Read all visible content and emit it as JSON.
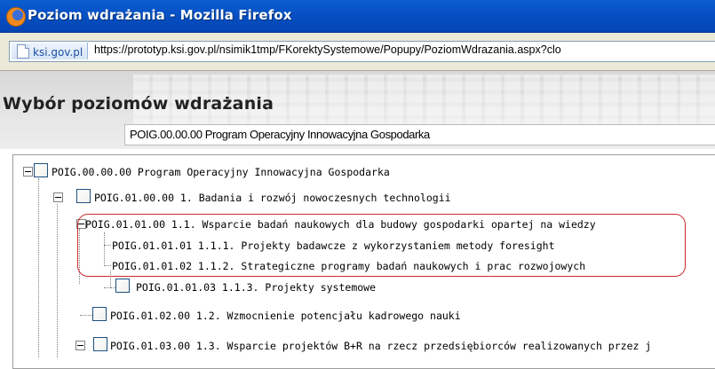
{
  "window": {
    "title": "Poziom wdrażania - Mozilla Firefox",
    "icon": "firefox-icon"
  },
  "urlbar": {
    "site_identity": "ksi.gov.pl",
    "url": "https://prototyp.ksi.gov.pl/nsimik1tmp/FKorektySystemowe/Popupy/PoziomWdrazania.aspx?clo"
  },
  "page": {
    "title": "Wybór poziomów wdrażania",
    "selected_value": "POIG.00.00.00 Program Operacyjny Innowacyjna Gospodarka"
  },
  "tree": {
    "nodes": [
      {
        "label": "POIG.00.00.00 Program Operacyjny Innowacyjna Gospodarka"
      },
      {
        "label": "POIG.01.00.00 1. Badania i rozwój nowoczesnych technologii"
      },
      {
        "label": "POIG.01.01.00 1.1. Wsparcie badań naukowych dla budowy gospodarki opartej na wiedzy"
      },
      {
        "label": "POIG.01.01.01 1.1.1. Projekty badawcze z wykorzystaniem metody foresight"
      },
      {
        "label": "POIG.01.01.02 1.1.2. Strategiczne programy badań naukowych i prac rozwojowych"
      },
      {
        "label": "POIG.01.01.03 1.1.3. Projekty systemowe"
      },
      {
        "label": "POIG.01.02.00 1.2. Wzmocnienie potencjału kadrowego nauki"
      },
      {
        "label": "POIG.01.03.00 1.3. Wsparcie projektów B+R na rzecz przedsiębiorców realizowanych przez j"
      }
    ]
  },
  "colors": {
    "titlebar": "#0751c6",
    "highlight": "#cc2a2a"
  }
}
